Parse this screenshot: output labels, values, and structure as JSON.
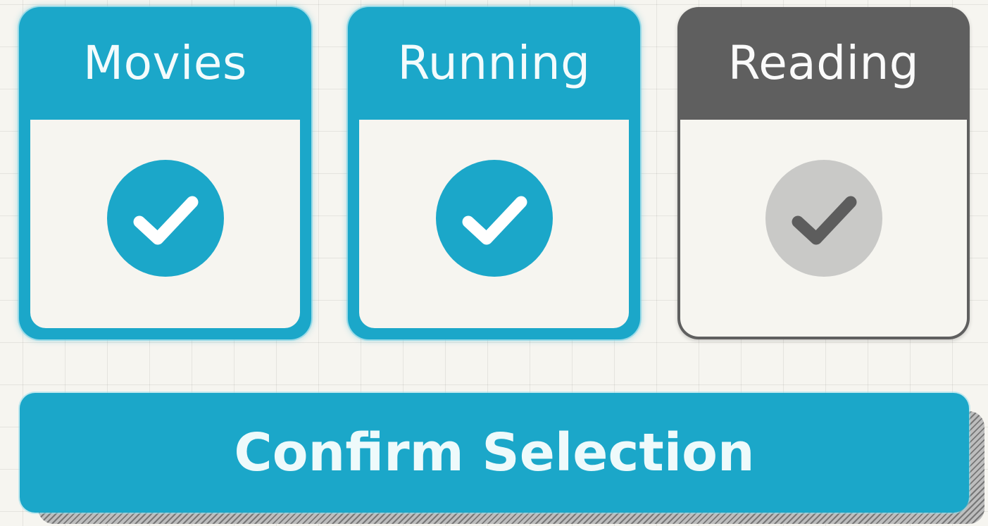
{
  "interests": [
    {
      "label": "Movies",
      "selected": true,
      "icon": "checkmark-icon"
    },
    {
      "label": "Running",
      "selected": true,
      "icon": "checkmark-icon"
    },
    {
      "label": "Reading",
      "selected": false,
      "icon": "checkmark-icon"
    }
  ],
  "confirm": {
    "label": "Confirm Selection"
  },
  "colors": {
    "accent": "#1ba7c9",
    "inactive": "#5f5f5f",
    "background": "#f6f5f0"
  }
}
